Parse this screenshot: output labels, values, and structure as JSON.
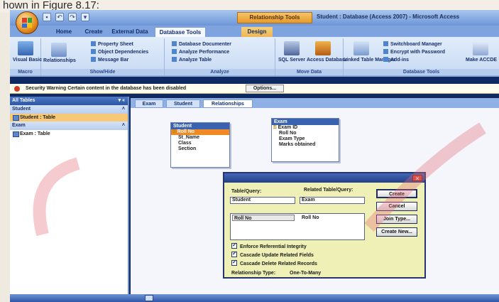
{
  "caption": "hown in Figure 8.17:",
  "window": {
    "contextual_tab": "Relationship Tools",
    "title": "Student : Database (Access 2007) - Microsoft Access"
  },
  "ribbon_tabs": [
    "Home",
    "Create",
    "External Data",
    "Database Tools",
    "Design"
  ],
  "ribbon_active_tab": "Database Tools",
  "ribbon": {
    "macro": {
      "label": "Macro",
      "visual_basic": "Visual Basic"
    },
    "show_hide": {
      "relationships": "Relationships",
      "property_sheet": "Property Sheet",
      "object_dependencies": "Object Dependencies",
      "message_bar": "Message Bar",
      "label": "Show/Hide"
    },
    "analyze": {
      "documenter": "Database Documenter",
      "performance": "Analyze Performance",
      "analyze_table": "Analyze Table",
      "label": "Analyze"
    },
    "move_data": {
      "sql_server": "SQL Server",
      "access_database": "Access Database",
      "label": "Move Data"
    },
    "database_tools": {
      "linked_table_manager": "Linked Table Manager",
      "switchboard_manager": "Switchboard Manager",
      "encrypt": "Encrypt with Password",
      "addins": "Add-ins",
      "make_accde": "Make ACCDE",
      "label": "Database Tools"
    }
  },
  "security": {
    "text": "Security Warning   Certain content in the database has been disabled",
    "options_button": "Options..."
  },
  "nav": {
    "header": "All Tables",
    "groups": [
      {
        "name": "Student",
        "items": [
          "Student : Table"
        ]
      },
      {
        "name": "Exam",
        "items": [
          "Exam : Table"
        ]
      }
    ]
  },
  "doc_tabs": [
    "Exam",
    "Student",
    "Relationships"
  ],
  "active_doc_tab": "Relationships",
  "student_table": {
    "title": "Student",
    "fields": [
      "Roll No",
      "St_Name",
      "Class",
      "Section"
    ]
  },
  "exam_table": {
    "title": "Exam",
    "fields": [
      "Exam ID",
      "Roll No",
      "Exam Type",
      "Marks obtained"
    ]
  },
  "dialog": {
    "table_query_label": "Table/Query:",
    "related_label": "Related Table/Query:",
    "table": "Student",
    "related_table": "Exam",
    "field": "Roll No",
    "related_field": "Roll No",
    "enforce": "Enforce Referential Integrity",
    "cascade_update": "Cascade Update Related Fields",
    "cascade_delete": "Cascade Delete Related Records",
    "relationship_type_label": "Relationship Type:",
    "relationship_type": "One-To-Many",
    "buttons": [
      "Create",
      "Cancel",
      "Join Type...",
      "Create New..."
    ]
  }
}
